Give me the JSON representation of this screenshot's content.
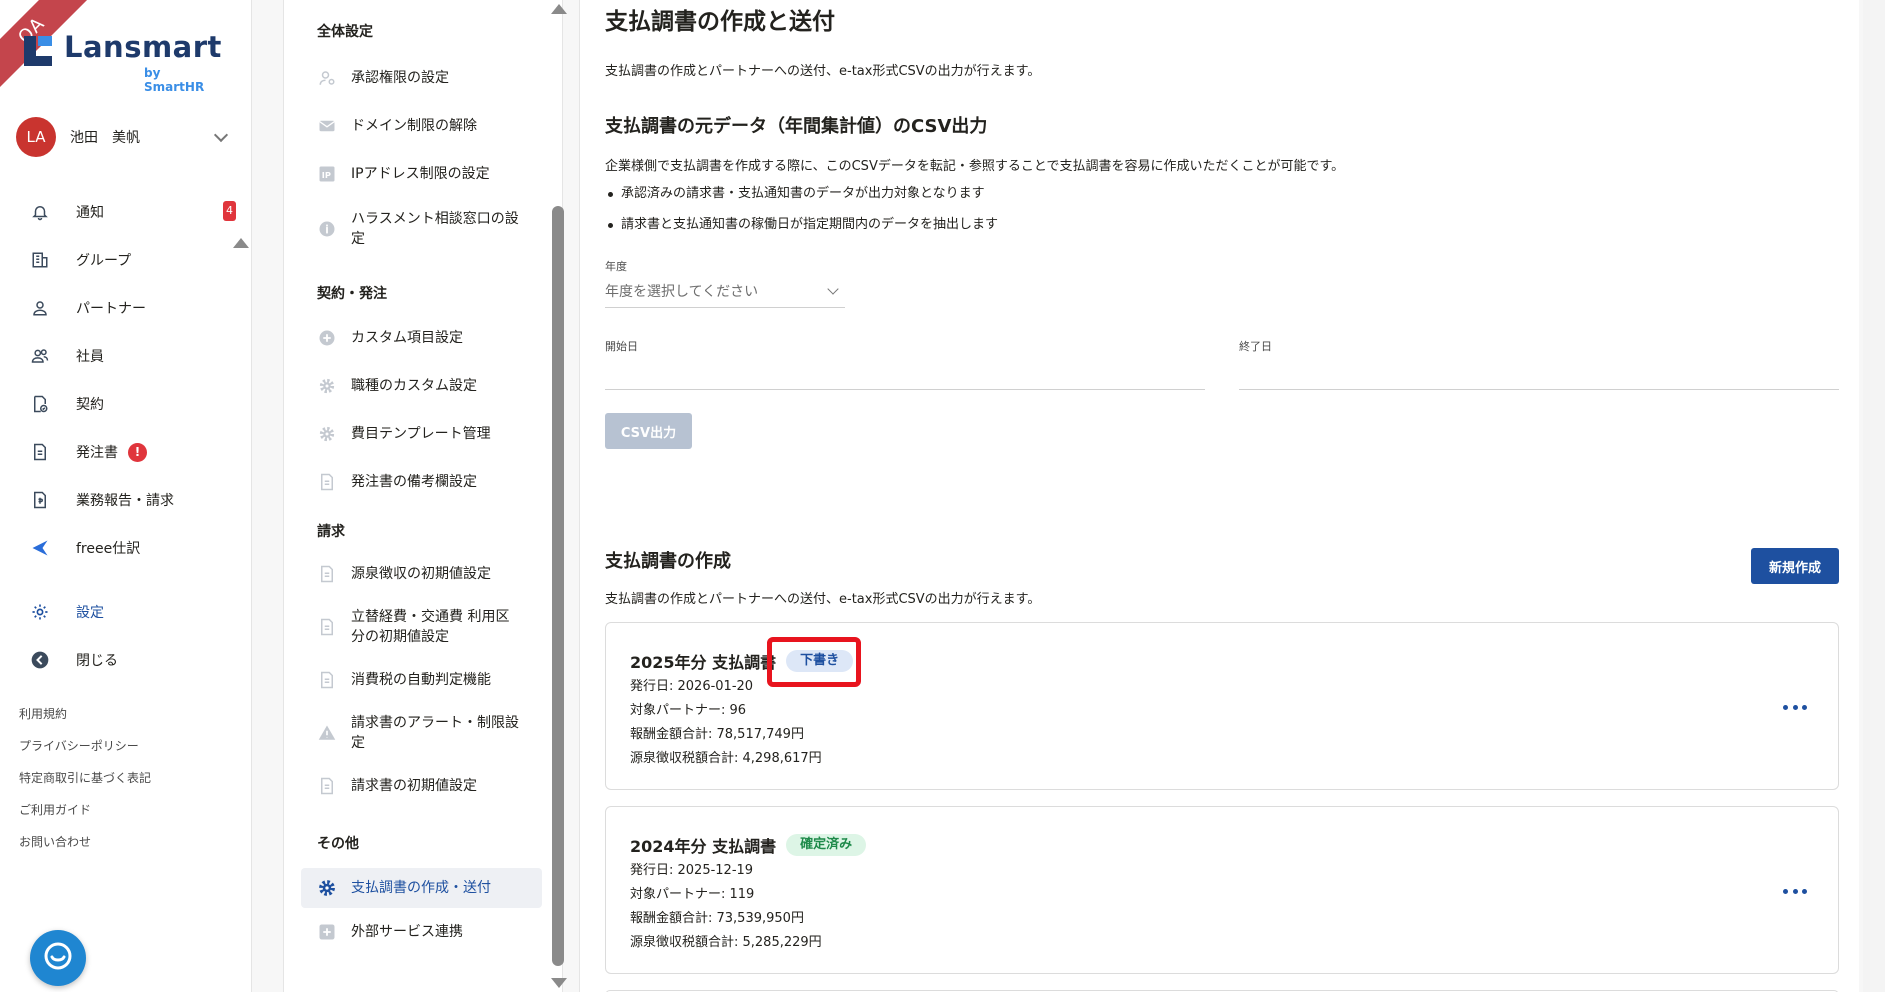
{
  "qa_ribbon": "QA",
  "logo": {
    "name": "Lansmart",
    "sub": "by SmartHR"
  },
  "user": {
    "initials": "LA",
    "name": "池田　美帆"
  },
  "nav": {
    "items": [
      {
        "label": "通知",
        "icon": "bell-icon",
        "count": "4"
      },
      {
        "label": "グループ",
        "icon": "building-icon"
      },
      {
        "label": "パートナー",
        "icon": "person-icon"
      },
      {
        "label": "社員",
        "icon": "people-icon"
      },
      {
        "label": "契約",
        "icon": "contract-icon"
      },
      {
        "label": "発注書",
        "icon": "document-icon",
        "alert": "!"
      },
      {
        "label": "業務報告・請求",
        "icon": "invoice-icon"
      },
      {
        "label": "freee仕訳",
        "icon": "freee-icon"
      },
      {
        "label": "設定",
        "icon": "gear-icon"
      },
      {
        "label": "閉じる",
        "icon": "collapse-icon"
      }
    ],
    "footer_links": [
      "利用規約",
      "プライバシーポリシー",
      "特定商取引に基づく表記",
      "ご利用ガイド",
      "お問い合わせ"
    ]
  },
  "submenu": {
    "sections": [
      {
        "title": "全体設定",
        "items": [
          "承認権限の設定",
          "ドメイン制限の解除",
          "IPアドレス制限の設定",
          "ハラスメント相談窓口の設定"
        ]
      },
      {
        "title": "契約・発注",
        "items": [
          "カスタム項目設定",
          "職種のカスタム設定",
          "費目テンプレート管理",
          "発注書の備考欄設定"
        ]
      },
      {
        "title": "請求",
        "items": [
          "源泉徴収の初期値設定",
          "立替経費・交通費 利用区分の初期値設定",
          "消費税の自動判定機能",
          "請求書のアラート・制限設定",
          "請求書の初期値設定"
        ]
      },
      {
        "title": "その他",
        "items": [
          "支払調書の作成・送付",
          "外部サービス連携"
        ]
      }
    ],
    "active": "支払調書の作成・送付"
  },
  "main": {
    "title": "支払調書の作成と送付",
    "description": "支払調書の作成とパートナーへの送付、e-tax形式CSVの出力が行えます。",
    "csv_section": {
      "title": "支払調書の元データ（年間集計値）のCSV出力",
      "body": "企業様側で支払調書を作成する際に、このCSVデータを転記・参照することで支払調書を容易に作成いただくことが可能です。",
      "bullets": [
        "承認済みの請求書・支払通知書のデータが出力対象となります",
        "請求書と支払通知書の稼働日が指定期間内のデータを抽出します"
      ],
      "year_label": "年度",
      "year_placeholder": "年度を選択してください",
      "start_label": "開始日",
      "end_label": "終了日",
      "button": "CSV出力"
    },
    "create_section": {
      "title": "支払調書の作成",
      "description": "支払調書の作成とパートナーへの送付、e-tax形式CSVの出力が行えます。",
      "new_button": "新規作成"
    },
    "cards": [
      {
        "title": "2025年分 支払調書",
        "status": "下書き",
        "issue_date": "発行日: 2026-01-20",
        "partners": "対象パートナー: 96",
        "total": "報酬金額合計: 78,517,749円",
        "tax": "源泉徴収税額合計: 4,298,617円"
      },
      {
        "title": "2024年分 支払調書",
        "status": "確定済み",
        "issue_date": "発行日: 2025-12-19",
        "partners": "対象パートナー: 119",
        "total": "報酬金額合計: 73,539,950円",
        "tax": "源泉徴収税額合計: 5,285,229円"
      }
    ]
  },
  "colors": {
    "primary": "#1e50a0",
    "alert": "#e0353c",
    "highlight": "#e8141e",
    "draft_bg": "#dde7f7",
    "final_bg": "#ddf5e6"
  }
}
